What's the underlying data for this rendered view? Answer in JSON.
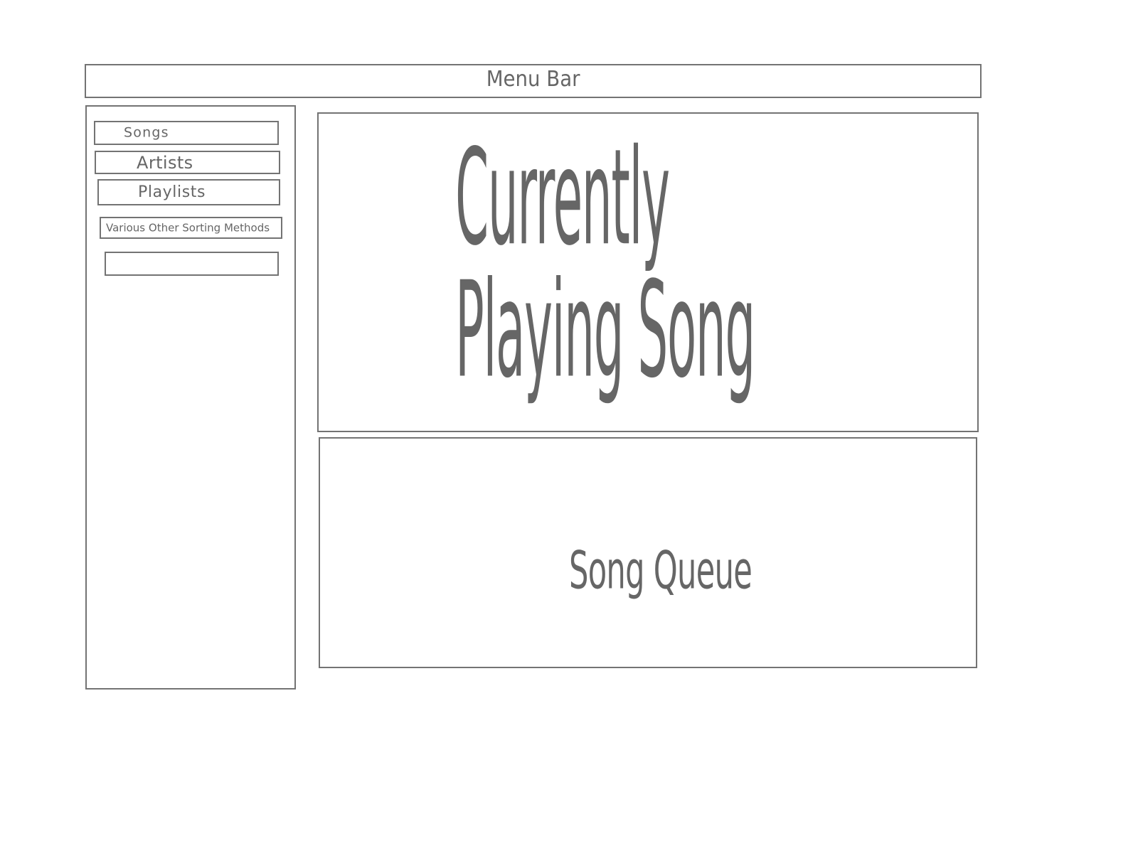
{
  "menu_bar": {
    "label": "Menu Bar"
  },
  "sidebar": {
    "items": [
      {
        "label": "Songs"
      },
      {
        "label": "Artists"
      },
      {
        "label": "Playlists"
      },
      {
        "label": "Various Other Sorting Methods"
      },
      {
        "label": ""
      }
    ]
  },
  "now_playing": {
    "label": "Currently Playing Song"
  },
  "queue": {
    "label": "Song Queue"
  },
  "colors": {
    "stroke": "#737373",
    "text": "#666666",
    "background": "#ffffff"
  }
}
